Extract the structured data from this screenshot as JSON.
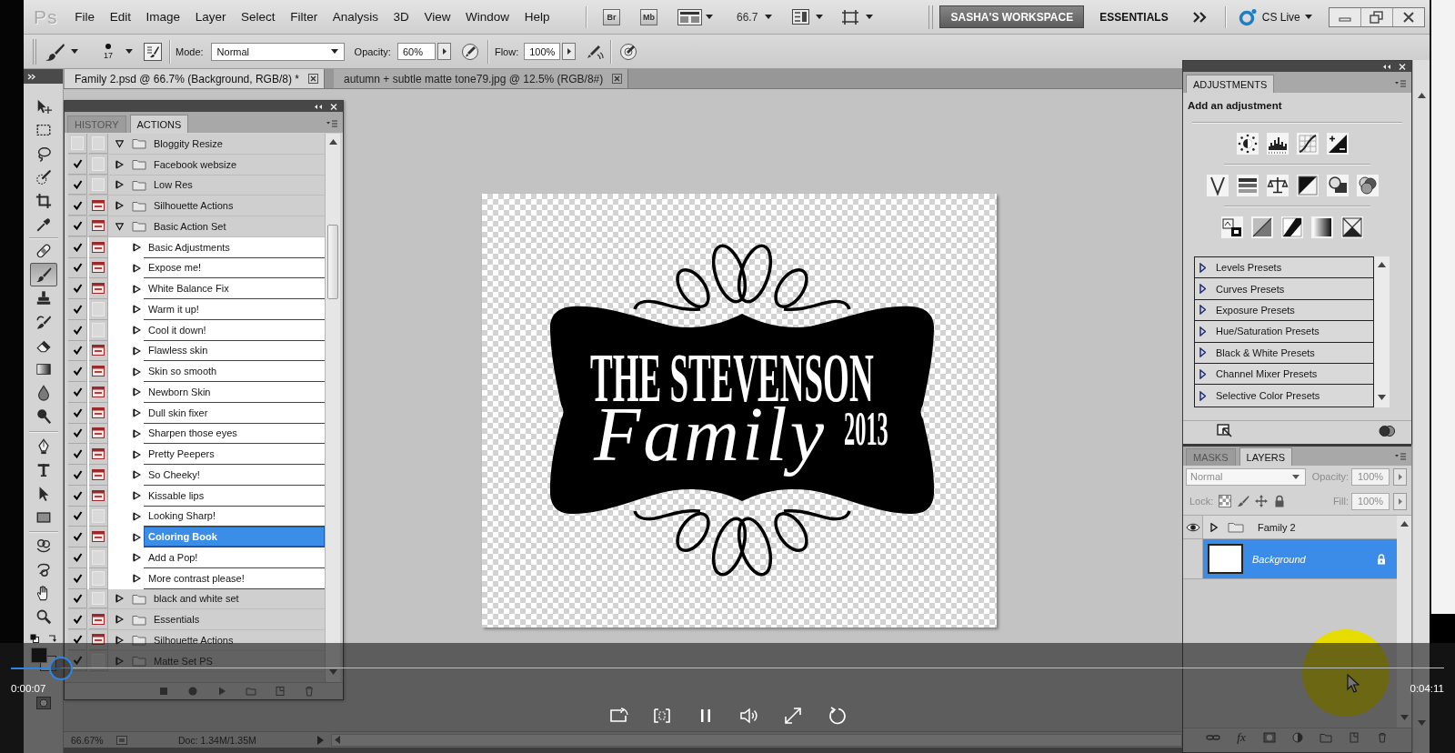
{
  "video_player": {
    "playing": true,
    "elapsed": "0:00:07",
    "duration": "0:04:11",
    "progress": {
      "level": 0.035
    }
  },
  "menu_bar": {
    "logo": "Ps",
    "items": [
      "File",
      "Edit",
      "Image",
      "Layer",
      "Select",
      "Filter",
      "Analysis",
      "3D",
      "View",
      "Window",
      "Help"
    ],
    "bridge_button": "Br",
    "mini_bridge_button": "Mb",
    "zoom": "66.7",
    "workspaces": [
      {
        "label": "SASHA'S WORKSPACE",
        "selected": true
      },
      {
        "label": "ESSENTIALS",
        "selected": false
      }
    ],
    "cs_live": "CS Live"
  },
  "options_bar": {
    "brush_size": "17",
    "mode_label": "Mode:",
    "mode": "Normal",
    "opacity_label": "Opacity:",
    "opacity": "60%",
    "flow_label": "Flow:",
    "flow": "100%"
  },
  "document_tabs": [
    {
      "title": "Family 2.psd @ 66.7% (Background, RGB/8) *",
      "selected": true
    },
    {
      "title": "autumn + subtle matte tone79.jpg @ 12.5% (RGB/8#)",
      "selected": false
    }
  ],
  "toolbar": {
    "tools": [
      {
        "selected": false
      },
      {
        "selected": false
      },
      {
        "selected": false
      },
      {
        "selected": false
      },
      {
        "selected": false
      },
      {
        "selected": false
      },
      {
        "selected": false
      },
      {
        "selected": true
      },
      {
        "selected": false
      },
      {
        "selected": false
      },
      {
        "selected": false
      },
      {
        "selected": false
      },
      {
        "selected": false
      },
      {
        "selected": false
      },
      {
        "selected": false
      },
      {
        "selected": false
      },
      {
        "selected": false
      },
      {
        "selected": false
      },
      {
        "selected": false
      },
      {
        "selected": false
      },
      {
        "selected": false
      },
      {
        "selected": false
      }
    ]
  },
  "actions_panel": {
    "tabs": [
      {
        "label": "HISTORY",
        "selected": false
      },
      {
        "label": "ACTIONS",
        "selected": true
      }
    ],
    "sets": [
      {
        "name": "Bloggity Resize",
        "checked": false,
        "dialog": false,
        "expanded": true,
        "selected": false
      },
      {
        "name": "Facebook websize",
        "checked": true,
        "dialog": false,
        "expanded": false,
        "selected": false
      },
      {
        "name": "Low Res",
        "checked": true,
        "dialog": false,
        "expanded": false,
        "selected": false
      },
      {
        "name": "Silhouette Actions",
        "checked": true,
        "dialog": true,
        "expanded": false,
        "selected": false
      },
      {
        "name": "Basic Action Set",
        "checked": true,
        "dialog": true,
        "expanded": true,
        "selected": false,
        "children": [
          {
            "name": "Basic Adjustments",
            "checked": true,
            "dialog": true,
            "expanded": false,
            "selected": false
          },
          {
            "name": "Expose me!",
            "checked": true,
            "dialog": true,
            "expanded": false,
            "selected": false
          },
          {
            "name": "White Balance Fix",
            "checked": true,
            "dialog": true,
            "expanded": false,
            "selected": false
          },
          {
            "name": "Warm it up!",
            "checked": true,
            "dialog": false,
            "expanded": false,
            "selected": false
          },
          {
            "name": "Cool it down!",
            "checked": true,
            "dialog": false,
            "expanded": false,
            "selected": false
          },
          {
            "name": "Flawless skin",
            "checked": true,
            "dialog": true,
            "expanded": false,
            "selected": false
          },
          {
            "name": "Skin so smooth",
            "checked": true,
            "dialog": true,
            "expanded": false,
            "selected": false
          },
          {
            "name": "Newborn Skin",
            "checked": true,
            "dialog": true,
            "expanded": false,
            "selected": false
          },
          {
            "name": "Dull skin fixer",
            "checked": true,
            "dialog": true,
            "expanded": false,
            "selected": false
          },
          {
            "name": "Sharpen those eyes",
            "checked": true,
            "dialog": true,
            "expanded": false,
            "selected": false
          },
          {
            "name": "Pretty Peepers",
            "checked": true,
            "dialog": true,
            "expanded": false,
            "selected": false
          },
          {
            "name": "So Cheeky!",
            "checked": true,
            "dialog": true,
            "expanded": false,
            "selected": false
          },
          {
            "name": "Kissable lips",
            "checked": true,
            "dialog": true,
            "expanded": false,
            "selected": false
          },
          {
            "name": "Looking Sharp!",
            "checked": true,
            "dialog": false,
            "expanded": false,
            "selected": false
          },
          {
            "name": "Coloring Book",
            "checked": true,
            "dialog": true,
            "expanded": false,
            "selected": true
          },
          {
            "name": "Add a Pop!",
            "checked": true,
            "dialog": false,
            "expanded": false,
            "selected": false
          },
          {
            "name": "More contrast please!",
            "checked": true,
            "dialog": false,
            "expanded": false,
            "selected": false
          }
        ]
      },
      {
        "name": "black and white set",
        "checked": true,
        "dialog": false,
        "expanded": false,
        "selected": false
      },
      {
        "name": "Essentials",
        "checked": true,
        "dialog": true,
        "expanded": false,
        "selected": false
      },
      {
        "name": "Silhouette Actions",
        "checked": true,
        "dialog": true,
        "expanded": false,
        "selected": false
      },
      {
        "name": "Matte Set PS",
        "checked": true,
        "dialog": false,
        "expanded": false,
        "selected": false
      }
    ]
  },
  "document": {
    "line_1": "THE STEVENSON",
    "script": "Family",
    "year": "2013"
  },
  "adjustments_panel": {
    "tabs": [
      {
        "label": "ADJUSTMENTS",
        "selected": true
      }
    ],
    "heading": "Add an adjustment",
    "presets": [
      {
        "label": "Levels Presets",
        "expanded": false
      },
      {
        "label": "Curves Presets",
        "expanded": false
      },
      {
        "label": "Exposure Presets",
        "expanded": false
      },
      {
        "label": "Hue/Saturation Presets",
        "expanded": false
      },
      {
        "label": "Black & White Presets",
        "expanded": false
      },
      {
        "label": "Channel Mixer Presets",
        "expanded": false
      },
      {
        "label": "Selective Color Presets",
        "expanded": false
      }
    ]
  },
  "layers_panel": {
    "tabs": [
      {
        "label": "MASKS",
        "selected": false
      },
      {
        "label": "LAYERS",
        "selected": true
      }
    ],
    "controls_disabled": true,
    "blend_mode": "Normal",
    "opacity_label": "Opacity:",
    "opacity": "100%",
    "lock_label": "Lock:",
    "fill_label": "Fill:",
    "fill": "100%",
    "layers": [
      {
        "name": "Family 2",
        "kind": "group",
        "visible": true,
        "expanded": false,
        "selected": false,
        "locked": false
      },
      {
        "name": "Background",
        "kind": "layer",
        "visible": false,
        "selected": true,
        "locked": true
      }
    ],
    "fx_button": "fx"
  },
  "status_bar": {
    "zoom": "66.67%",
    "doc_info": "Doc: 1.34M/1.35M"
  }
}
